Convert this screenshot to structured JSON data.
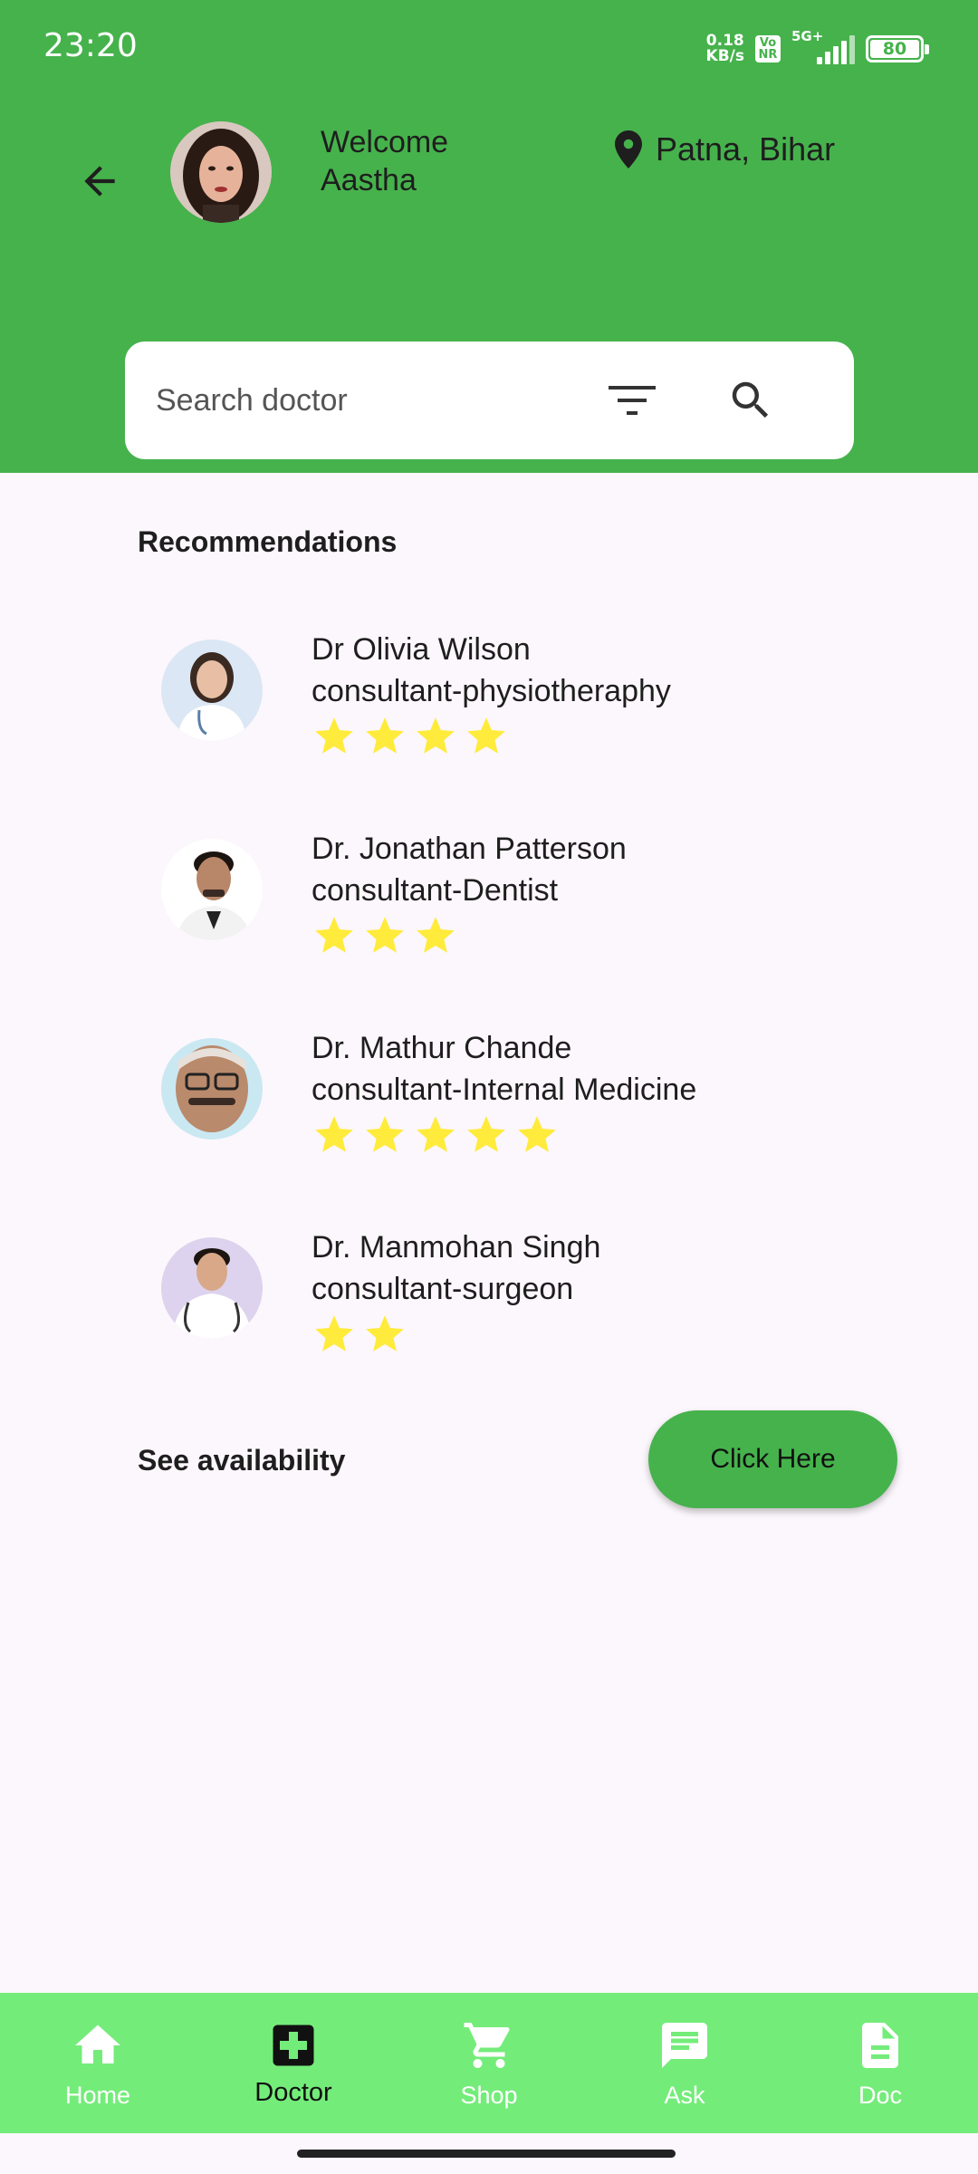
{
  "status_bar": {
    "time": "23:20",
    "net_speed_value": "0.18",
    "net_speed_unit": "KB/s",
    "volte_top": "Vo",
    "volte_bottom": "NR",
    "network": "5G+",
    "battery": "80"
  },
  "header": {
    "welcome_line1": "Welcome",
    "welcome_line2": "Aastha",
    "location": "Patna, Bihar"
  },
  "search": {
    "placeholder": "Search doctor"
  },
  "recommendations": {
    "title": "Recommendations",
    "doctors": [
      {
        "name": "Dr Olivia Wilson",
        "specialty": "consultant-physiotheraphy",
        "rating": 4
      },
      {
        "name": "Dr. Jonathan Patterson",
        "specialty": "consultant-Dentist",
        "rating": 3
      },
      {
        "name": "Dr. Mathur Chande",
        "specialty": "consultant-Internal Medicine",
        "rating": 5
      },
      {
        "name": "Dr. Manmohan Singh",
        "specialty": "consultant-surgeon",
        "rating": 2
      }
    ]
  },
  "availability": {
    "label": "See availability",
    "button": "Click Here"
  },
  "bottom_nav": {
    "items": [
      {
        "label": "Home",
        "icon": "home-icon"
      },
      {
        "label": "Doctor",
        "icon": "medical-cross-icon"
      },
      {
        "label": "Shop",
        "icon": "cart-icon"
      },
      {
        "label": "Ask",
        "icon": "chat-icon"
      },
      {
        "label": "Doc",
        "icon": "document-icon"
      }
    ],
    "active": "Doctor"
  },
  "colors": {
    "header_bg": "#46b24c",
    "nav_bg": "#74ec7a",
    "star": "#ffeb3b",
    "page_bg": "#fcf7fc"
  }
}
